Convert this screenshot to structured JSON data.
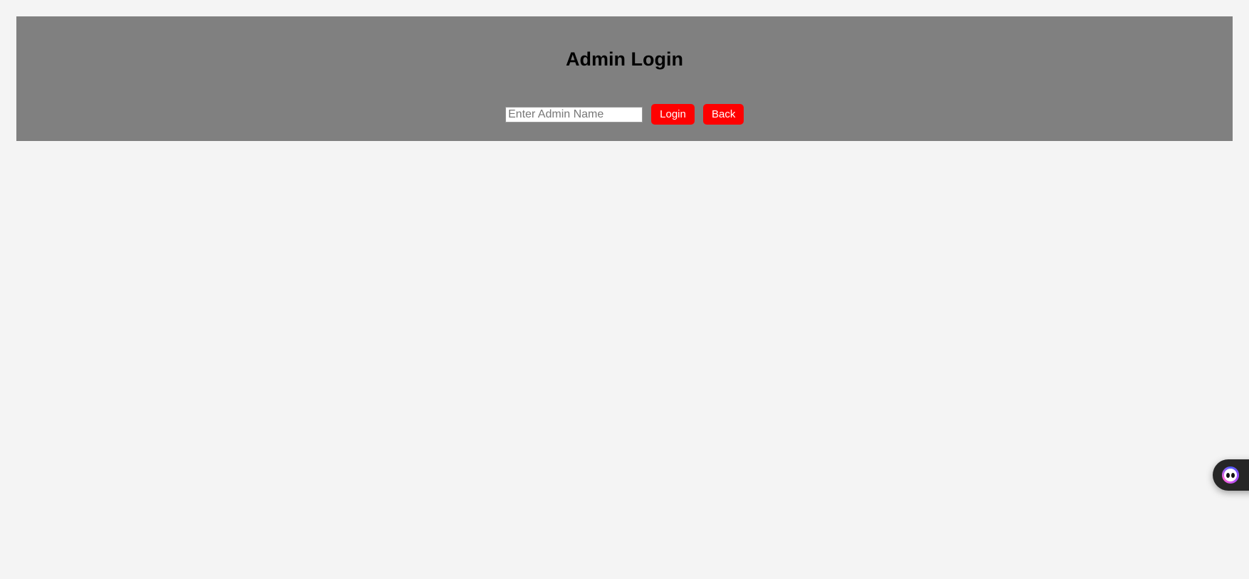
{
  "login": {
    "title": "Admin Login",
    "admin_name_placeholder": "Enter Admin Name",
    "admin_name_value": "",
    "login_button": "Login",
    "back_button": "Back"
  },
  "colors": {
    "page_background": "#f4f4f4",
    "panel_background": "#808080",
    "button_background": "#ff0000",
    "button_text": "#ffffff"
  },
  "floating_widget": {
    "icon": "assistant-face-icon"
  }
}
